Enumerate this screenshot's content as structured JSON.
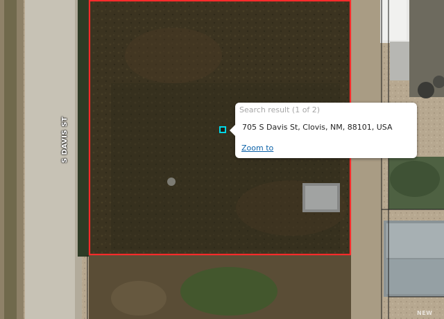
{
  "map": {
    "street_label": "S DAVIS ST",
    "parcel_color": "#ff2b2b",
    "marker_color": "#00d7e8",
    "watermark": "NEW"
  },
  "popup": {
    "title": "Search result (1 of 2)",
    "address": "705 S Davis St, Clovis, NM, 88101, USA",
    "zoom_link": "Zoom to"
  }
}
